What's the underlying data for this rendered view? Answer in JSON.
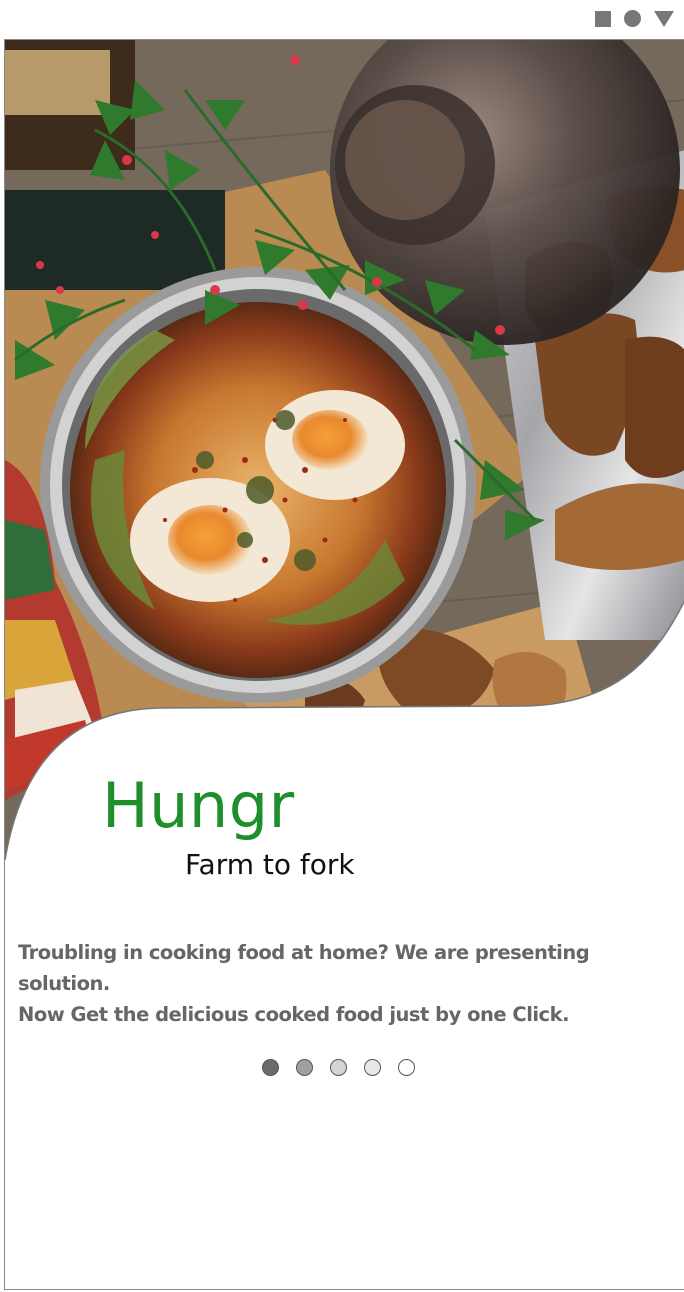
{
  "status_bar": {
    "icons": [
      "square-icon",
      "circle-icon",
      "triangle-icon"
    ],
    "icon_color": "#777777"
  },
  "hero": {
    "image": "food-photo-shakshuka-and-toast"
  },
  "brand": {
    "name": "Hungr",
    "tagline": "Farm to fork",
    "accent_color": "#1f8f2b"
  },
  "intro": {
    "line1": "Troubling in cooking food at home? We are presenting solution.",
    "line2": "Now Get the delicious cooked food just by one Click."
  },
  "pagination": {
    "count": 5,
    "active_index": 0,
    "dot_colors": [
      "#6b6b6b",
      "#a0a0a0",
      "#d4d4d4",
      "#e8e8e8",
      "#ffffff"
    ]
  }
}
